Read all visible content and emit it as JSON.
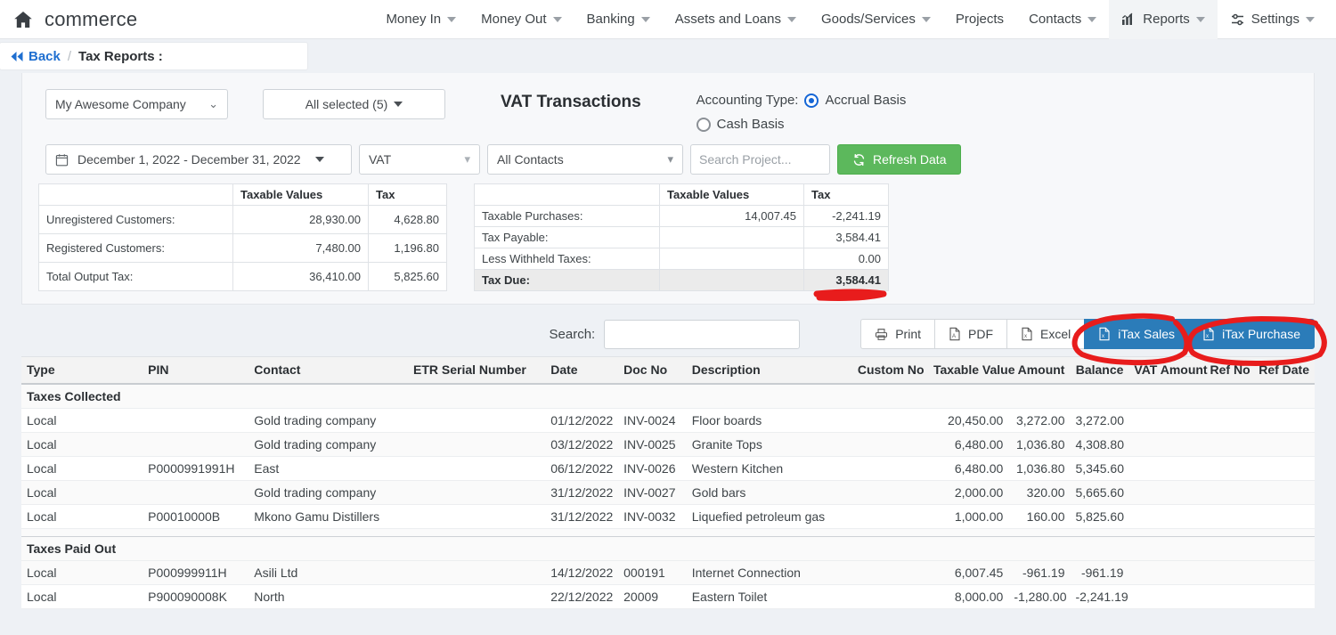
{
  "navbar": {
    "home_icon": "home-icon",
    "brand": "commerce",
    "items": [
      {
        "label": "Money In",
        "caret": true,
        "icon": null,
        "active": false
      },
      {
        "label": "Money Out",
        "caret": true,
        "icon": null,
        "active": false
      },
      {
        "label": "Banking",
        "caret": true,
        "icon": null,
        "active": false
      },
      {
        "label": "Assets and Loans",
        "caret": true,
        "icon": null,
        "active": false
      },
      {
        "label": "Goods/Services",
        "caret": true,
        "icon": null,
        "active": false
      },
      {
        "label": "Projects",
        "caret": false,
        "icon": null,
        "active": false
      },
      {
        "label": "Contacts",
        "caret": true,
        "icon": null,
        "active": false
      },
      {
        "label": "Reports",
        "caret": true,
        "icon": "chart-bar-icon",
        "active": true
      },
      {
        "label": "Settings",
        "caret": true,
        "icon": "sliders-icon",
        "active": false
      }
    ]
  },
  "breadcrumb": {
    "back_label": "Back",
    "separator": "/",
    "title": "Tax Reports :"
  },
  "filters": {
    "company": "My Awesome Company",
    "entities": "All selected (5)",
    "report_title": "VAT Transactions",
    "accounting_type_label": "Accounting Type:",
    "accrual_label": "Accrual Basis",
    "cash_label": "Cash Basis",
    "accounting_selected": "Accrual Basis",
    "date_range": "December 1, 2022 - December 31, 2022",
    "tax_type": "VAT",
    "contacts": "All Contacts",
    "project_search_value": "",
    "project_search_placeholder": "Search Project...",
    "refresh_label": "Refresh Data",
    "refresh_icon": "refresh-icon",
    "calendar_icon": "calendar-icon"
  },
  "summary_left": {
    "headers": [
      "",
      "Taxable Values",
      "Tax"
    ],
    "rows": [
      {
        "label": "Unregistered Customers:",
        "taxable": "28,930.00",
        "tax": "4,628.80"
      },
      {
        "label": "Registered Customers:",
        "taxable": "7,480.00",
        "tax": "1,196.80"
      },
      {
        "label": "Total Output Tax:",
        "taxable": "36,410.00",
        "tax": "5,825.60"
      }
    ]
  },
  "summary_right": {
    "headers": [
      "",
      "Taxable Values",
      "Tax"
    ],
    "rows": [
      {
        "label": "Taxable Purchases:",
        "taxable": "14,007.45",
        "tax": "-2,241.19"
      },
      {
        "label": "Tax Payable:",
        "taxable": "",
        "tax": "3,584.41"
      },
      {
        "label": "Less Withheld Taxes:",
        "taxable": "",
        "tax": "0.00"
      }
    ],
    "total": {
      "label": "Tax Due:",
      "taxable": "",
      "tax": "3,584.41"
    }
  },
  "toolbar": {
    "search_label": "Search:",
    "search_value": "",
    "search_placeholder": "",
    "buttons": [
      {
        "label": "Print",
        "icon": "printer-icon",
        "style": "light"
      },
      {
        "label": "PDF",
        "icon": "pdf-file-icon",
        "style": "light"
      },
      {
        "label": "Excel",
        "icon": "excel-file-icon",
        "style": "light"
      },
      {
        "label": "iTax Sales",
        "icon": "excel-file-icon",
        "style": "blue"
      },
      {
        "label": "iTax Purchase",
        "icon": "excel-file-icon",
        "style": "blue"
      }
    ]
  },
  "table": {
    "headers": [
      "Type",
      "PIN",
      "Contact",
      "ETR Serial Number",
      "Date",
      "Doc No",
      "Description",
      "Custom No",
      "Taxable Value",
      "Amount",
      "Balance",
      "VAT Amount",
      "Ref No",
      "Ref Date"
    ],
    "groups": [
      {
        "name": "Taxes Collected",
        "rows": [
          {
            "type": "Local",
            "pin": "",
            "contact": "Gold trading company",
            "etr": "",
            "date": "01/12/2022",
            "doc": "INV-0024",
            "desc": "Floor boards",
            "custom": "",
            "taxable": "20,450.00",
            "amount": "3,272.00",
            "balance": "3,272.00",
            "vat": "",
            "refno": "",
            "refdate": ""
          },
          {
            "type": "Local",
            "pin": "",
            "contact": "Gold trading company",
            "etr": "",
            "date": "03/12/2022",
            "doc": "INV-0025",
            "desc": "Granite Tops",
            "custom": "",
            "taxable": "6,480.00",
            "amount": "1,036.80",
            "balance": "4,308.80",
            "vat": "",
            "refno": "",
            "refdate": ""
          },
          {
            "type": "Local",
            "pin": "P0000991991H",
            "contact": "East",
            "etr": "",
            "date": "06/12/2022",
            "doc": "INV-0026",
            "desc": "Western Kitchen",
            "custom": "",
            "taxable": "6,480.00",
            "amount": "1,036.80",
            "balance": "5,345.60",
            "vat": "",
            "refno": "",
            "refdate": ""
          },
          {
            "type": "Local",
            "pin": "",
            "contact": "Gold trading company",
            "etr": "",
            "date": "31/12/2022",
            "doc": "INV-0027",
            "desc": "Gold bars",
            "custom": "",
            "taxable": "2,000.00",
            "amount": "320.00",
            "balance": "5,665.60",
            "vat": "",
            "refno": "",
            "refdate": ""
          },
          {
            "type": "Local",
            "pin": "P00010000B",
            "contact": "Mkono Gamu Distillers",
            "etr": "",
            "date": "31/12/2022",
            "doc": "INV-0032",
            "desc": "Liquefied petroleum gas",
            "custom": "",
            "taxable": "1,000.00",
            "amount": "160.00",
            "balance": "5,825.60",
            "vat": "",
            "refno": "",
            "refdate": ""
          }
        ]
      },
      {
        "name": "Taxes Paid Out",
        "rows": [
          {
            "type": "Local",
            "pin": "P000999911H",
            "contact": "Asili Ltd",
            "etr": "",
            "date": "14/12/2022",
            "doc": "000191",
            "desc": "Internet Connection",
            "custom": "",
            "taxable": "6,007.45",
            "amount": "-961.19",
            "balance": "-961.19",
            "vat": "",
            "refno": "",
            "refdate": ""
          },
          {
            "type": "Local",
            "pin": "P900090008K",
            "contact": "North",
            "etr": "",
            "date": "22/12/2022",
            "doc": "20009",
            "desc": "Eastern Toilet",
            "custom": "",
            "taxable": "8,000.00",
            "amount": "-1,280.00",
            "balance": "-2,241.19",
            "vat": "",
            "refno": "",
            "refdate": ""
          }
        ]
      }
    ]
  },
  "annotations": {
    "color": "#e81c1c",
    "marks": [
      {
        "name": "underline-tax-due",
        "shape": "underline"
      },
      {
        "name": "circle-itax-sales",
        "shape": "ellipse"
      },
      {
        "name": "circle-itax-purchase",
        "shape": "ellipse"
      }
    ]
  },
  "colors": {
    "accent_blue": "#2b7cb9",
    "link_blue": "#1f6fd0",
    "green": "#5cb85c",
    "annotation_red": "#e81c1c"
  }
}
